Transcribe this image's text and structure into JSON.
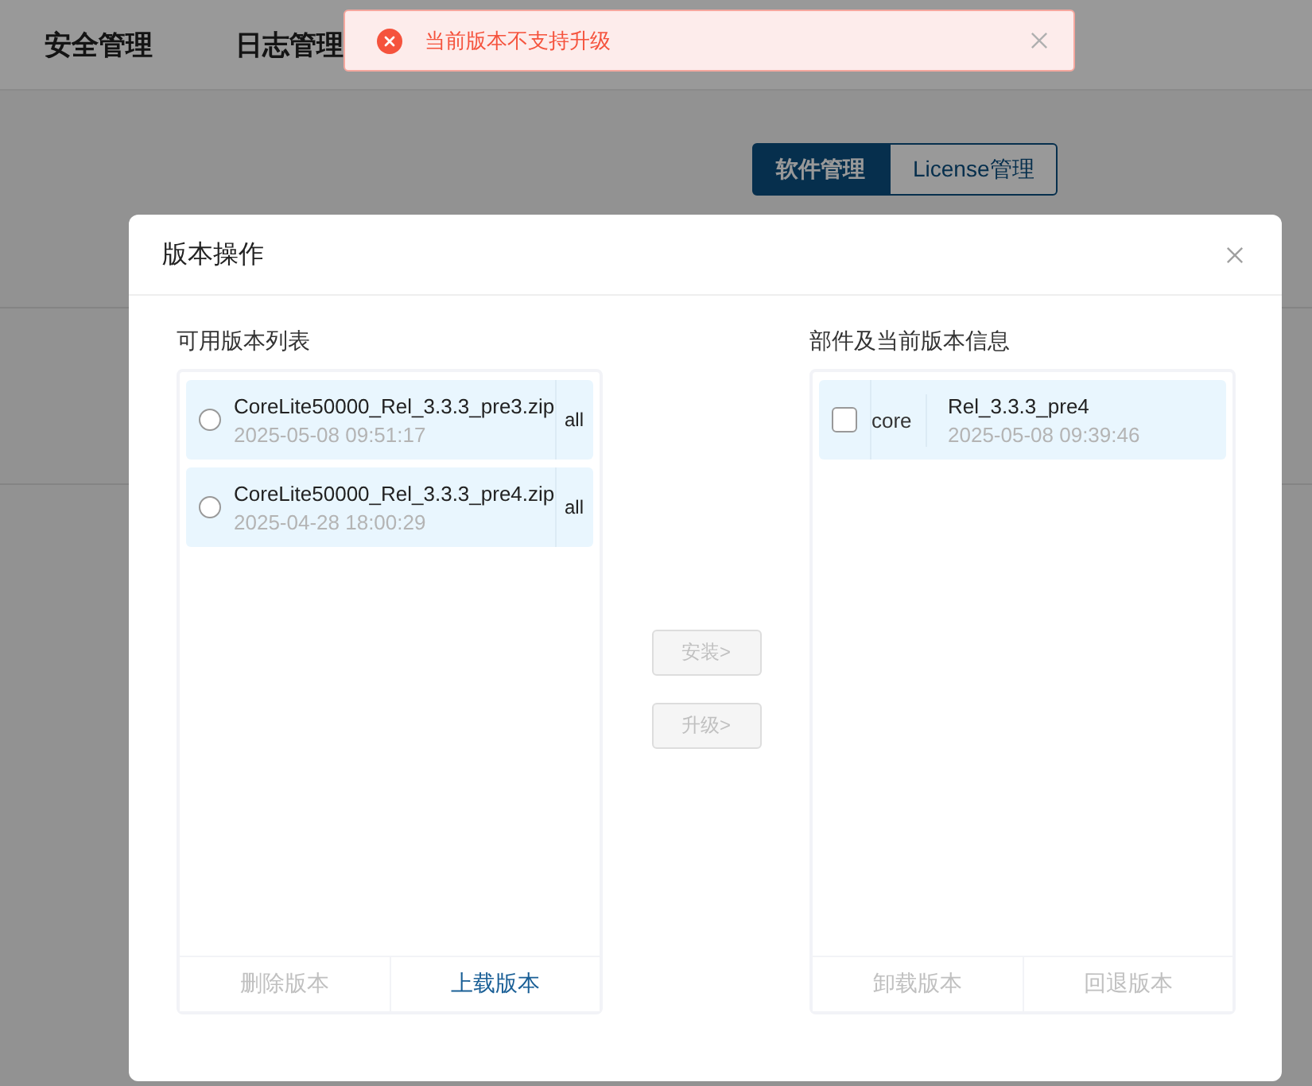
{
  "nav": {
    "items": [
      "安全管理",
      "日志管理"
    ]
  },
  "tabs": [
    {
      "label": "软件管理",
      "selected": true
    },
    {
      "label": "License管理",
      "selected": false
    }
  ],
  "toast": {
    "kind": "error",
    "message": "当前版本不支持升级"
  },
  "dialog": {
    "title": "版本操作",
    "available": {
      "title": "可用版本列表",
      "items": [
        {
          "name": "CoreLite50000_Rel_3.3.3_pre3.zip",
          "time": "2025-05-08 09:51:17",
          "scope": "all",
          "selected": false
        },
        {
          "name": "CoreLite50000_Rel_3.3.3_pre4.zip",
          "time": "2025-04-28 18:00:29",
          "scope": "all",
          "selected": false
        }
      ],
      "actions": [
        {
          "label": "删除版本",
          "disabled": true
        },
        {
          "label": "上载版本",
          "disabled": false
        }
      ]
    },
    "transfer": [
      {
        "label": "安装>",
        "disabled": true
      },
      {
        "label": "升级>",
        "disabled": true
      }
    ],
    "installed": {
      "title": "部件及当前版本信息",
      "items": [
        {
          "component": "core",
          "version": "Rel_3.3.3_pre4",
          "time": "2025-05-08 09:39:46",
          "checked": false
        }
      ],
      "actions": [
        {
          "label": "卸载版本",
          "disabled": true
        },
        {
          "label": "回退版本",
          "disabled": true
        }
      ]
    }
  }
}
